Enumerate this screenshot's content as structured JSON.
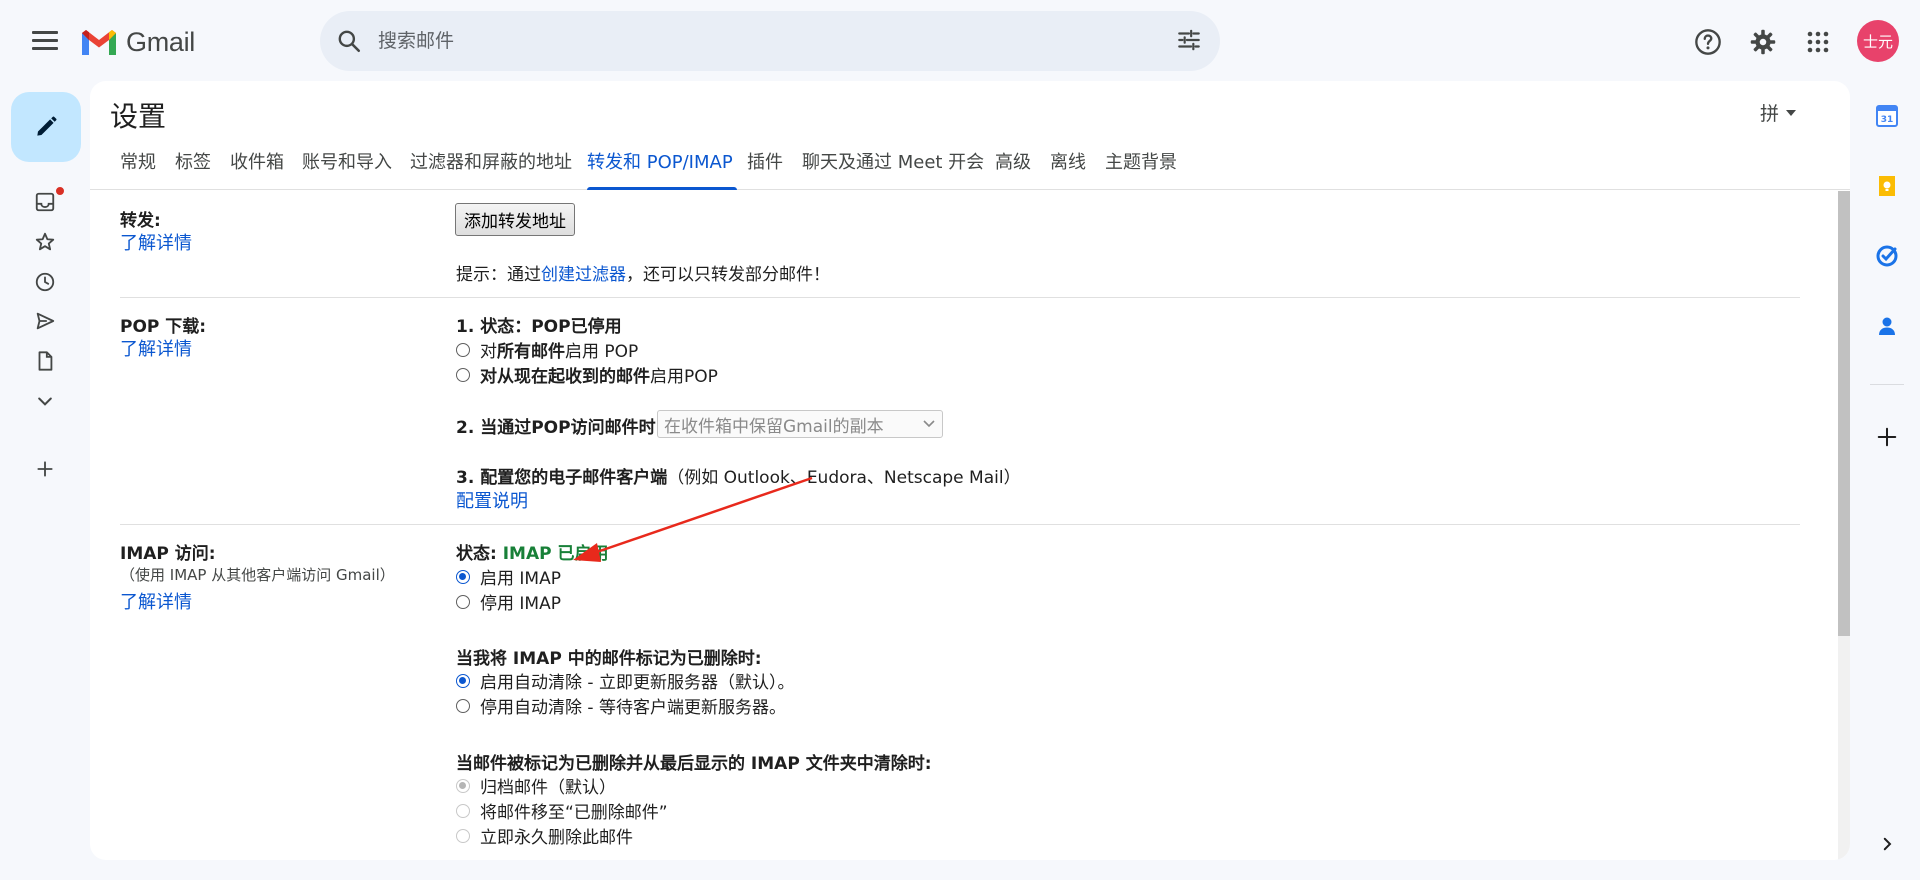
{
  "app": {
    "logo_text": "Gmail",
    "search_placeholder": "搜索邮件",
    "avatar_text": "士元"
  },
  "settings": {
    "title": "设置",
    "input_tool": "拼"
  },
  "tabs": [
    {
      "label": "常规"
    },
    {
      "label": "标签"
    },
    {
      "label": "收件箱"
    },
    {
      "label": "账号和导入"
    },
    {
      "label": "过滤器和屏蔽的地址"
    },
    {
      "label": "转发和 POP/IMAP"
    },
    {
      "label": "插件"
    },
    {
      "label": "聊天及通过 Meet 开会"
    },
    {
      "label": "高级"
    },
    {
      "label": "离线"
    },
    {
      "label": "主题背景"
    }
  ],
  "forwarding": {
    "label": "转发:",
    "learn_more": "了解详情",
    "add_button": "添加转发地址",
    "tip_prefix": "提示：通过",
    "tip_link": "创建过滤器",
    "tip_suffix": "，还可以只转发部分邮件！"
  },
  "pop": {
    "label": "POP 下载:",
    "learn_more": "了解详情",
    "status_label": "1. 状态：",
    "status_value": "POP已停用",
    "opt1_prefix": "对",
    "opt1_bold": "所有邮件",
    "opt1_suffix": "启用 POP",
    "opt2_bold": "对从现在起收到的邮件",
    "opt2_suffix": "启用POP",
    "access_label": "2. 当通过POP访问邮件时",
    "access_select": "在收件箱中保留Gmail的副本",
    "config_bold": "3. 配置您的电子邮件客户端",
    "config_normal": "（例如 Outlook、Eudora、Netscape Mail）",
    "config_link": "配置说明"
  },
  "imap": {
    "label": "IMAP 访问:",
    "sub": "（使用 IMAP 从其他客户端访问 Gmail）",
    "learn_more": "了解详情",
    "status_label": "状态:",
    "status_value": "IMAP 已启用",
    "enable": "启用 IMAP",
    "disable": "停用 IMAP",
    "delete_heading": "当我将 IMAP 中的邮件标记为已删除时:",
    "auto_on": "启用自动清除 - 立即更新服务器（默认）。",
    "auto_off": "停用自动清除 - 等待客户端更新服务器。",
    "expunge_heading": "当邮件被标记为已删除并从最后显示的 IMAP 文件夹中清除时:",
    "archive": "归档邮件（默认）",
    "move_trash": "将邮件移至“已删除邮件”",
    "delete_forever": "立即永久删除此邮件"
  },
  "right_rail": {
    "calendar_day": "31"
  },
  "colors": {
    "accent": "#0b57d0",
    "compose_bg": "#c2e7ff",
    "imap_enabled": "#188038",
    "arrow": "#e8291c",
    "avatar_bg": "#e8426b"
  }
}
